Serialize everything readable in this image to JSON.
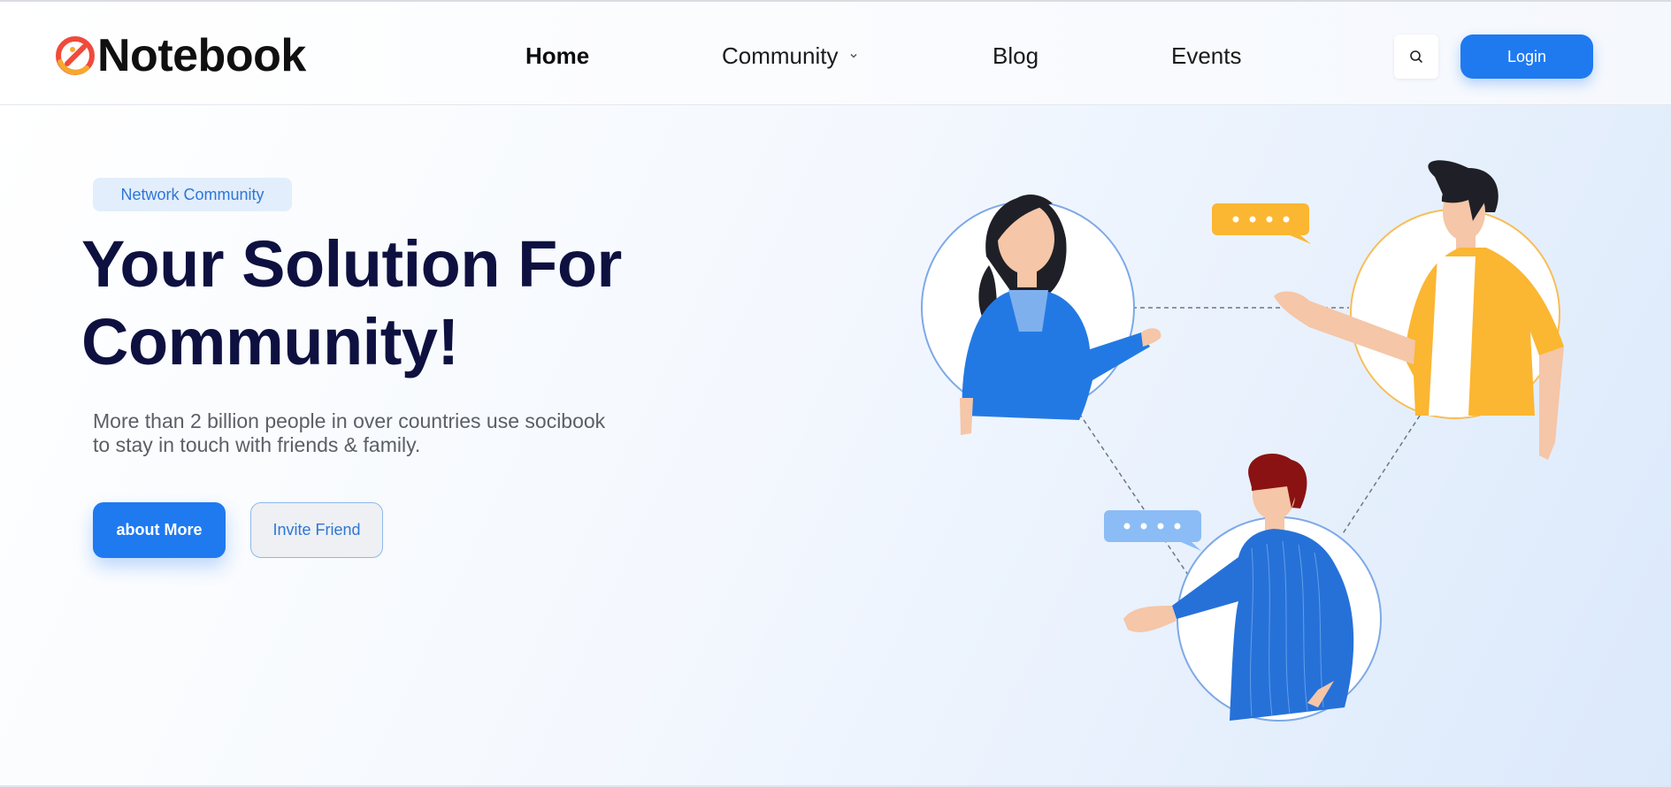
{
  "brand": {
    "name": "Notebook",
    "logo_icon": "notebook-logo-icon",
    "accent": "#1f7af0"
  },
  "nav": {
    "items": [
      {
        "label": "Home",
        "active": true
      },
      {
        "label": "Community",
        "active": false,
        "has_dropdown": true
      },
      {
        "label": "Blog",
        "active": false
      },
      {
        "label": "Events",
        "active": false
      }
    ],
    "search_icon": "search-icon",
    "login_label": "Login"
  },
  "hero": {
    "badge": "Network Community",
    "title_line1": "Your Solution For",
    "title_line2": "Community!",
    "subtitle_line1": "More than 2 billion people in over countries use socibook",
    "subtitle_line2": "to stay in touch with friends & family.",
    "primary_button": "about More",
    "secondary_button": "Invite Friend"
  },
  "colors": {
    "headline": "#0e1140",
    "primary": "#1f7af0",
    "badge_bg": "#e2eefc",
    "yellow": "#fbb632"
  }
}
